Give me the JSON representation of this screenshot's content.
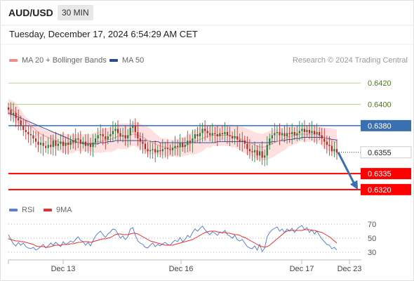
{
  "header": {
    "pair": "AUD/USD",
    "timeframe": "30 MIN",
    "datetime": "Tuesday, December 17, 2024 6:54:29 AM CET"
  },
  "legend": {
    "ma20_label": "MA 20 + Bollinger Bands",
    "ma50_label": "MA 50",
    "rsi_label": "RSI",
    "ma9_label": "9MA",
    "credit": "Research © 2024 Trading Central"
  },
  "colors": {
    "up_candle": "#1f7a3a",
    "down_candle": "#b3261e",
    "bollinger_band": "#ffd9d9",
    "ma20": "#e9a0a0",
    "ma50": "#3a4fa3",
    "resistance_line": "#b5d98a",
    "pivot_line": "#3a6fb0",
    "support_line": "#ff0000",
    "current_tag": "#222222",
    "rsi": "#5b7fd6",
    "rsi_ma": "#e83030",
    "arrow": "#3a6fb0"
  },
  "chart_data": [
    {
      "type": "candlestick",
      "title": "AUD/USD 30 MIN",
      "ylim": [
        0.6312,
        0.6432
      ],
      "x_ticks": [
        "Dec 13",
        "Dec 16",
        "Dec 17",
        "Dec 23"
      ],
      "levels": [
        {
          "value": 0.642,
          "label": "0.6420",
          "kind": "resistance"
        },
        {
          "value": 0.64,
          "label": "0.6400",
          "kind": "resistance"
        },
        {
          "value": 0.638,
          "label": "0.6380",
          "kind": "pivot"
        },
        {
          "value": 0.6355,
          "label": "0.6355",
          "kind": "current"
        },
        {
          "value": 0.6335,
          "label": "0.6335",
          "kind": "support"
        },
        {
          "value": 0.632,
          "label": "0.6320",
          "kind": "support"
        }
      ],
      "close": [
        0.6395,
        0.639,
        0.6392,
        0.6387,
        0.6385,
        0.638,
        0.6376,
        0.6374,
        0.6372,
        0.6371,
        0.6368,
        0.6365,
        0.6362,
        0.6364,
        0.6361,
        0.6359,
        0.6362,
        0.636,
        0.6366,
        0.6361,
        0.6363,
        0.6365,
        0.6361,
        0.6364,
        0.6362,
        0.6366,
        0.6364,
        0.6368,
        0.6367,
        0.6363,
        0.6365,
        0.6361,
        0.6363,
        0.636,
        0.6364,
        0.6368,
        0.6371,
        0.6372,
        0.637,
        0.6367,
        0.637,
        0.6372,
        0.6375,
        0.6377,
        0.6373,
        0.637,
        0.6371,
        0.6368,
        0.6371,
        0.6378,
        0.638,
        0.6374,
        0.6368,
        0.6365,
        0.6363,
        0.6358,
        0.6356,
        0.6357,
        0.6358,
        0.6355,
        0.6357,
        0.6356,
        0.6358,
        0.6359,
        0.6358,
        0.6357,
        0.6359,
        0.6361,
        0.636,
        0.6364,
        0.636,
        0.6362,
        0.6366,
        0.6364,
        0.6368,
        0.6372,
        0.637,
        0.6373,
        0.6377,
        0.6375,
        0.6373,
        0.6371,
        0.6373,
        0.6372,
        0.637,
        0.6373,
        0.6372,
        0.6374,
        0.6371,
        0.637,
        0.6368,
        0.637,
        0.6367,
        0.6365,
        0.6366,
        0.6363,
        0.6358,
        0.6356,
        0.6355,
        0.6357,
        0.6352,
        0.6356,
        0.635,
        0.6352,
        0.6362,
        0.6368,
        0.6371,
        0.6373,
        0.6374,
        0.6371,
        0.6373,
        0.637,
        0.6373,
        0.6372,
        0.6374,
        0.6371,
        0.6373,
        0.6375,
        0.6377,
        0.6374,
        0.6376,
        0.6373,
        0.6375,
        0.6372,
        0.6374,
        0.6371,
        0.6368,
        0.6365,
        0.6362,
        0.6361,
        0.6356,
        0.6358,
        0.6355
      ],
      "ma20": [
        0.6397,
        0.6396,
        0.6394,
        0.6392,
        0.639,
        0.6388,
        0.6386,
        0.6384,
        0.6382,
        0.638,
        0.6378,
        0.6376,
        0.6374,
        0.6372,
        0.6371,
        0.637,
        0.6369,
        0.6368,
        0.6367,
        0.6366,
        0.6365,
        0.6364,
        0.6364,
        0.6363,
        0.6363,
        0.6363,
        0.6363,
        0.6364,
        0.6364,
        0.6364,
        0.6364,
        0.6364,
        0.6364,
        0.6364,
        0.6364,
        0.6364,
        0.6365,
        0.6365,
        0.6366,
        0.6366,
        0.6367,
        0.6367,
        0.6368,
        0.6369,
        0.637,
        0.637,
        0.637,
        0.637,
        0.637,
        0.6371,
        0.6372,
        0.6372,
        0.6371,
        0.637,
        0.6369,
        0.6368,
        0.6366,
        0.6365,
        0.6364,
        0.6363,
        0.6362,
        0.6361,
        0.636,
        0.636,
        0.6359,
        0.6359,
        0.6359,
        0.6359,
        0.6359,
        0.636,
        0.636,
        0.6361,
        0.6362,
        0.6363,
        0.6364,
        0.6365,
        0.6366,
        0.6367,
        0.6368,
        0.6369,
        0.637,
        0.637,
        0.6371,
        0.6371,
        0.6371,
        0.6371,
        0.6371,
        0.6371,
        0.6371,
        0.6371,
        0.637,
        0.637,
        0.6369,
        0.6368,
        0.6367,
        0.6366,
        0.6365,
        0.6364,
        0.6363,
        0.6362,
        0.6361,
        0.636,
        0.636,
        0.636,
        0.6361,
        0.6362,
        0.6363,
        0.6364,
        0.6365,
        0.6366,
        0.6367,
        0.6368,
        0.6369,
        0.637,
        0.637,
        0.6371,
        0.6371,
        0.6372,
        0.6372,
        0.6372,
        0.6372,
        0.6372,
        0.6372,
        0.6372,
        0.6372,
        0.6371,
        0.637,
        0.6369,
        0.6368,
        0.6367,
        0.6366,
        0.6365,
        0.6364
      ],
      "bb_upper": [
        0.6405,
        0.6404,
        0.6403,
        0.6401,
        0.6398,
        0.6395,
        0.6391,
        0.6388,
        0.6386,
        0.6384,
        0.6382,
        0.638,
        0.6379,
        0.6378,
        0.6377,
        0.6376,
        0.6375,
        0.6375,
        0.6374,
        0.6374,
        0.6373,
        0.6373,
        0.6373,
        0.6372,
        0.6372,
        0.6372,
        0.6372,
        0.6372,
        0.6372,
        0.6372,
        0.6372,
        0.6372,
        0.6372,
        0.6372,
        0.6373,
        0.6374,
        0.6375,
        0.6376,
        0.6377,
        0.6377,
        0.6378,
        0.6379,
        0.638,
        0.6381,
        0.6381,
        0.6382,
        0.6382,
        0.6382,
        0.6382,
        0.6382,
        0.6383,
        0.6383,
        0.6383,
        0.6382,
        0.6381,
        0.638,
        0.6379,
        0.6377,
        0.6375,
        0.6373,
        0.6371,
        0.6369,
        0.6368,
        0.6368,
        0.6367,
        0.6367,
        0.6367,
        0.6367,
        0.6368,
        0.6369,
        0.6369,
        0.637,
        0.6372,
        0.6373,
        0.6375,
        0.6377,
        0.6378,
        0.6379,
        0.638,
        0.638,
        0.638,
        0.6381,
        0.6381,
        0.6381,
        0.6381,
        0.6381,
        0.6381,
        0.6381,
        0.6381,
        0.6381,
        0.6381,
        0.638,
        0.638,
        0.6379,
        0.6379,
        0.6378,
        0.6377,
        0.6376,
        0.6375,
        0.6374,
        0.6373,
        0.6373,
        0.6372,
        0.6373,
        0.6374,
        0.6375,
        0.6376,
        0.6377,
        0.6377,
        0.6378,
        0.6378,
        0.6379,
        0.6379,
        0.6379,
        0.6379,
        0.6379,
        0.6379,
        0.6379,
        0.6379,
        0.6379,
        0.6379,
        0.6379,
        0.6379,
        0.6379,
        0.6379,
        0.6379,
        0.6379,
        0.6378,
        0.6378,
        0.6378,
        0.6377,
        0.6377,
        0.6376
      ],
      "bb_lower": [
        0.6389,
        0.6388,
        0.6385,
        0.6383,
        0.6382,
        0.6381,
        0.6381,
        0.638,
        0.6378,
        0.6376,
        0.6374,
        0.6372,
        0.6369,
        0.6366,
        0.6365,
        0.6364,
        0.6363,
        0.6361,
        0.636,
        0.6358,
        0.6357,
        0.6355,
        0.6355,
        0.6354,
        0.6354,
        0.6354,
        0.6354,
        0.6356,
        0.6356,
        0.6356,
        0.6356,
        0.6356,
        0.6356,
        0.6356,
        0.6355,
        0.6354,
        0.6355,
        0.6354,
        0.6355,
        0.6355,
        0.6356,
        0.6355,
        0.6356,
        0.6357,
        0.6359,
        0.6358,
        0.6358,
        0.6358,
        0.6358,
        0.636,
        0.6361,
        0.6361,
        0.6359,
        0.6358,
        0.6357,
        0.6356,
        0.6353,
        0.6353,
        0.6353,
        0.6353,
        0.6353,
        0.6353,
        0.6352,
        0.6352,
        0.6351,
        0.6351,
        0.6351,
        0.6351,
        0.635,
        0.6351,
        0.6351,
        0.6352,
        0.6352,
        0.6353,
        0.6353,
        0.6353,
        0.6354,
        0.6355,
        0.6356,
        0.6358,
        0.636,
        0.6359,
        0.6361,
        0.6361,
        0.6361,
        0.6361,
        0.6361,
        0.6361,
        0.6361,
        0.6361,
        0.6359,
        0.636,
        0.6358,
        0.6357,
        0.6355,
        0.6354,
        0.6353,
        0.6352,
        0.6351,
        0.635,
        0.6349,
        0.6347,
        0.6348,
        0.6347,
        0.6348,
        0.6349,
        0.635,
        0.6351,
        0.6353,
        0.6354,
        0.6356,
        0.6357,
        0.6359,
        0.6361,
        0.6361,
        0.6363,
        0.6363,
        0.6365,
        0.6365,
        0.6365,
        0.6365,
        0.6365,
        0.6365,
        0.6365,
        0.6365,
        0.6363,
        0.6361,
        0.6359,
        0.6357,
        0.6356,
        0.6355,
        0.6353,
        0.6352
      ],
      "ma50": [
        0.6392,
        0.6391,
        0.639,
        0.6389,
        0.6388,
        0.6387,
        0.6386,
        0.6385,
        0.6384,
        0.6383,
        0.6382,
        0.6381,
        0.638,
        0.6379,
        0.6378,
        0.6377,
        0.6376,
        0.6375,
        0.6374,
        0.6373,
        0.6372,
        0.6371,
        0.637,
        0.6369,
        0.6368,
        0.6367,
        0.6366,
        0.6365,
        0.6364,
        0.6364,
        0.6363,
        0.6363,
        0.6363,
        0.6363,
        0.6363,
        0.6363,
        0.6363,
        0.6364,
        0.6364,
        0.6364,
        0.6365,
        0.6365,
        0.6365,
        0.6366,
        0.6366,
        0.6366,
        0.6366,
        0.6366,
        0.6366,
        0.6366,
        0.6366,
        0.6366,
        0.6366,
        0.6366,
        0.6366,
        0.6366,
        0.6366,
        0.6365,
        0.6365,
        0.6365,
        0.6365,
        0.6364,
        0.6364,
        0.6364,
        0.6364,
        0.6364,
        0.6364,
        0.6364,
        0.6364,
        0.6364,
        0.6364,
        0.6364,
        0.6364,
        0.6364,
        0.6364,
        0.6364,
        0.6364,
        0.6364,
        0.6364,
        0.6364,
        0.6364,
        0.6364,
        0.6364,
        0.6364,
        0.6365,
        0.6365,
        0.6365,
        0.6365,
        0.6365,
        0.6365,
        0.6365,
        0.6365,
        0.6365,
        0.6365,
        0.6365,
        0.6365,
        0.6364,
        0.6364,
        0.6364,
        0.6364,
        0.6364,
        0.6364,
        0.6364,
        0.6364,
        0.6364,
        0.6364,
        0.6365,
        0.6365,
        0.6365,
        0.6366,
        0.6366,
        0.6366,
        0.6367,
        0.6367,
        0.6367,
        0.6368,
        0.6368,
        0.6368,
        0.6369,
        0.6369,
        0.6369,
        0.6369,
        0.6369,
        0.6369,
        0.6369,
        0.6369,
        0.6369,
        0.6369,
        0.6368,
        0.6368,
        0.6367,
        0.6367,
        0.6366
      ]
    },
    {
      "type": "line",
      "title": "RSI",
      "ylim": [
        25,
        75
      ],
      "y_ticks": [
        30,
        50,
        70
      ],
      "series": [
        {
          "name": "RSI",
          "values": [
            55,
            48,
            42,
            39,
            44,
            40,
            43,
            38,
            36,
            35,
            37,
            33,
            35,
            38,
            41,
            36,
            39,
            43,
            40,
            44,
            41,
            38,
            45,
            41,
            43,
            46,
            44,
            48,
            52,
            47,
            45,
            40,
            44,
            39,
            46,
            53,
            57,
            60,
            55,
            51,
            56,
            59,
            63,
            62,
            56,
            50,
            53,
            48,
            52,
            63,
            65,
            54,
            46,
            43,
            41,
            37,
            36,
            40,
            43,
            38,
            41,
            39,
            42,
            44,
            41,
            40,
            44,
            47,
            45,
            51,
            45,
            48,
            54,
            51,
            58,
            63,
            60,
            64,
            67,
            62,
            58,
            55,
            59,
            57,
            54,
            59,
            57,
            61,
            55,
            53,
            50,
            54,
            48,
            46,
            48,
            43,
            38,
            36,
            35,
            39,
            33,
            41,
            31,
            36,
            52,
            58,
            62,
            64,
            66,
            60,
            63,
            58,
            63,
            60,
            64,
            58,
            63,
            66,
            68,
            62,
            65,
            58,
            62,
            56,
            60,
            54,
            49,
            45,
            41,
            40,
            35,
            37,
            33
          ]
        },
        {
          "name": "9MA",
          "values": [
            49,
            48,
            47,
            46,
            46,
            45,
            45,
            44,
            43,
            42,
            41,
            39,
            38,
            38,
            38,
            37,
            37,
            38,
            39,
            40,
            40,
            40,
            41,
            41,
            41,
            42,
            42,
            43,
            44,
            44,
            45,
            45,
            45,
            44,
            45,
            46,
            47,
            48,
            49,
            49,
            50,
            51,
            53,
            55,
            56,
            56,
            55,
            55,
            55,
            56,
            57,
            57,
            56,
            54,
            52,
            50,
            48,
            46,
            45,
            44,
            43,
            42,
            41,
            40,
            40,
            40,
            40,
            41,
            42,
            43,
            44,
            45,
            46,
            47,
            48,
            50,
            52,
            54,
            56,
            58,
            59,
            60,
            60,
            60,
            59,
            58,
            58,
            58,
            57,
            57,
            56,
            55,
            55,
            54,
            52,
            51,
            49,
            47,
            45,
            43,
            41,
            39,
            38,
            37,
            38,
            40,
            43,
            46,
            49,
            52,
            55,
            58,
            60,
            61,
            61,
            61,
            61,
            61,
            61,
            62,
            62,
            62,
            61,
            61,
            60,
            59,
            58,
            56,
            54,
            52,
            49,
            46,
            43
          ]
        }
      ]
    }
  ]
}
